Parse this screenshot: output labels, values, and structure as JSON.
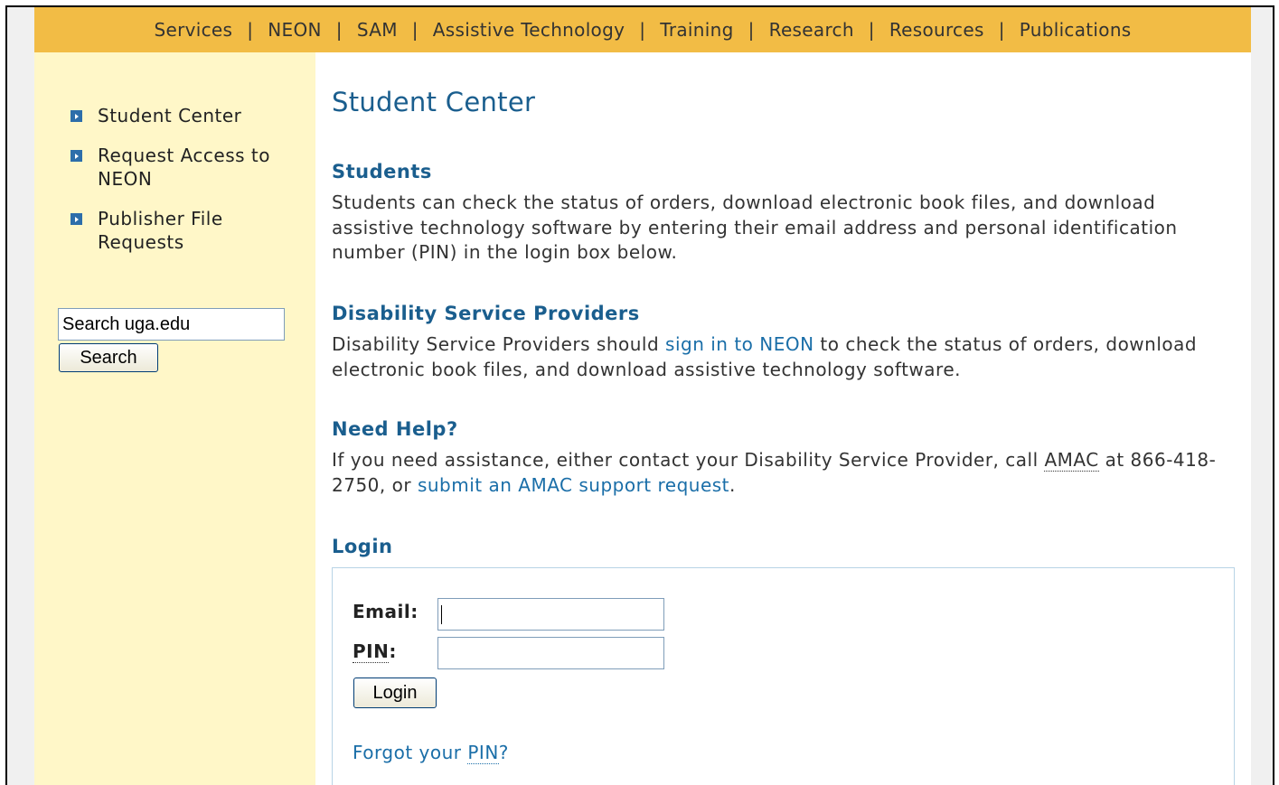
{
  "topnav": {
    "items": [
      "Services",
      "NEON",
      "SAM",
      "Assistive Technology",
      "Training",
      "Research",
      "Resources",
      "Publications"
    ],
    "separator": "|",
    "background": "#f2bc45"
  },
  "sidebar": {
    "background": "#fff7c8",
    "items": [
      {
        "label": "Student Center"
      },
      {
        "label": "Request Access to NEON"
      },
      {
        "label": "Publisher File Requests"
      }
    ],
    "search": {
      "value": "Search uga.edu",
      "button_label": "Search"
    }
  },
  "main": {
    "title": "Student Center",
    "students": {
      "heading": "Students",
      "text": "Students can check the status of orders, download electronic book files, and download assistive technology software by entering their email address and personal identification number (PIN) in the login box below."
    },
    "dsp": {
      "heading": "Disability Service Providers",
      "text_before": "Disability Service Providers should ",
      "link": "sign in to NEON",
      "text_after": " to check the status of orders, download electronic book files, and download assistive technology software."
    },
    "help": {
      "heading": "Need Help?",
      "text_before": "If you need assistance, either contact your Disability Service Provider, call ",
      "abbr": "AMAC",
      "text_middle": " at 866-418-2750, or ",
      "link": "submit an AMAC support request",
      "text_after": "."
    },
    "login": {
      "heading": "Login",
      "email_label": "Email:",
      "pin_label_abbr": "PIN",
      "pin_label_suffix": ":",
      "email_value": "",
      "pin_value": "",
      "button_label": "Login",
      "forgot_text": "Forgot your ",
      "forgot_abbr": "PIN",
      "forgot_suffix": "?"
    }
  },
  "colors": {
    "heading": "#1a5e8e",
    "link": "#1a6ea8",
    "bullet": "#2d6eaa"
  }
}
